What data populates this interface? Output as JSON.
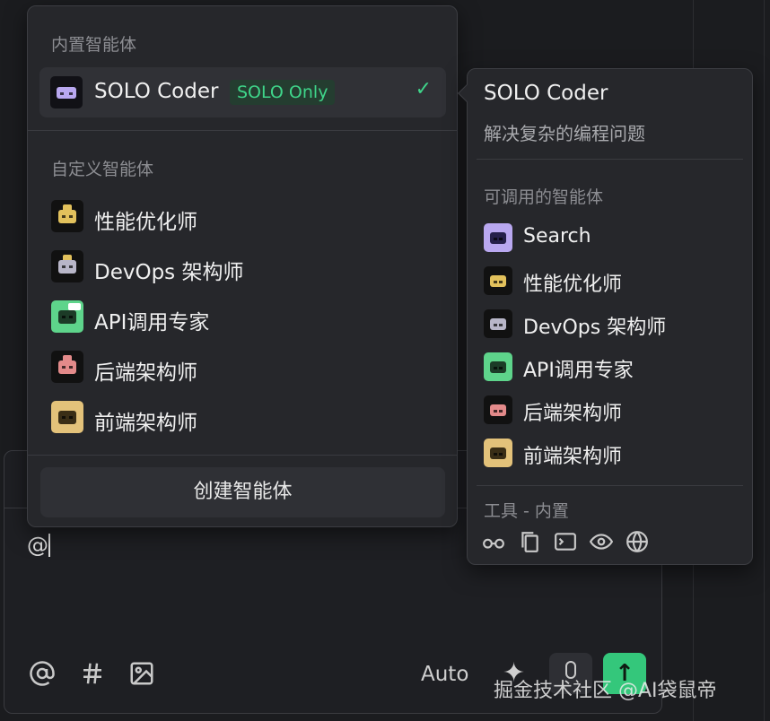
{
  "builtin": {
    "section_title": "内置智能体",
    "selected_agent": {
      "name": "SOLO Coder",
      "badge": "SOLO Only",
      "checked": true
    }
  },
  "custom": {
    "section_title": "自定义智能体",
    "agents": [
      {
        "name": "性能优化师",
        "icon": "robot-yellow-icon",
        "color": "#e2c15c"
      },
      {
        "name": "DevOps 架构师",
        "icon": "robot-gray-icon",
        "color": "#b8b6c8"
      },
      {
        "name": "API调用专家",
        "icon": "robot-green-icon",
        "color": "#5ed48b"
      },
      {
        "name": "后端架构师",
        "icon": "robot-red-icon",
        "color": "#e38a8a"
      },
      {
        "name": "前端架构师",
        "icon": "robot-tan-icon",
        "color": "#e3c27a"
      }
    ]
  },
  "create_button": "创建智能体",
  "tooltip": {
    "title": "SOLO Coder",
    "description": "解决复杂的编程问题",
    "callable_title": "可调用的智能体",
    "callable_agents": [
      {
        "name": "Search",
        "icon": "robot-purple-icon",
        "color": "#b9a8f0"
      },
      {
        "name": "性能优化师",
        "icon": "robot-yellow-icon",
        "color": "#e2c15c"
      },
      {
        "name": "DevOps 架构师",
        "icon": "robot-gray-icon",
        "color": "#b8b6c8"
      },
      {
        "name": "API调用专家",
        "icon": "robot-green-icon",
        "color": "#5ed48b"
      },
      {
        "name": "后端架构师",
        "icon": "robot-red-icon",
        "color": "#e38a8a"
      },
      {
        "name": "前端架构师",
        "icon": "robot-tan-icon",
        "color": "#e3c27a"
      }
    ],
    "tools_title": "工具 - 内置",
    "tools": [
      "glasses-icon",
      "copy-file-icon",
      "terminal-icon",
      "eye-icon",
      "globe-icon"
    ]
  },
  "chat": {
    "input_value": "@",
    "mode_label": "Auto"
  },
  "watermark": "掘金技术社区 @AI袋鼠帝",
  "colors": {
    "accent_green": "#34c77b",
    "badge_green": "#3fd58a"
  }
}
